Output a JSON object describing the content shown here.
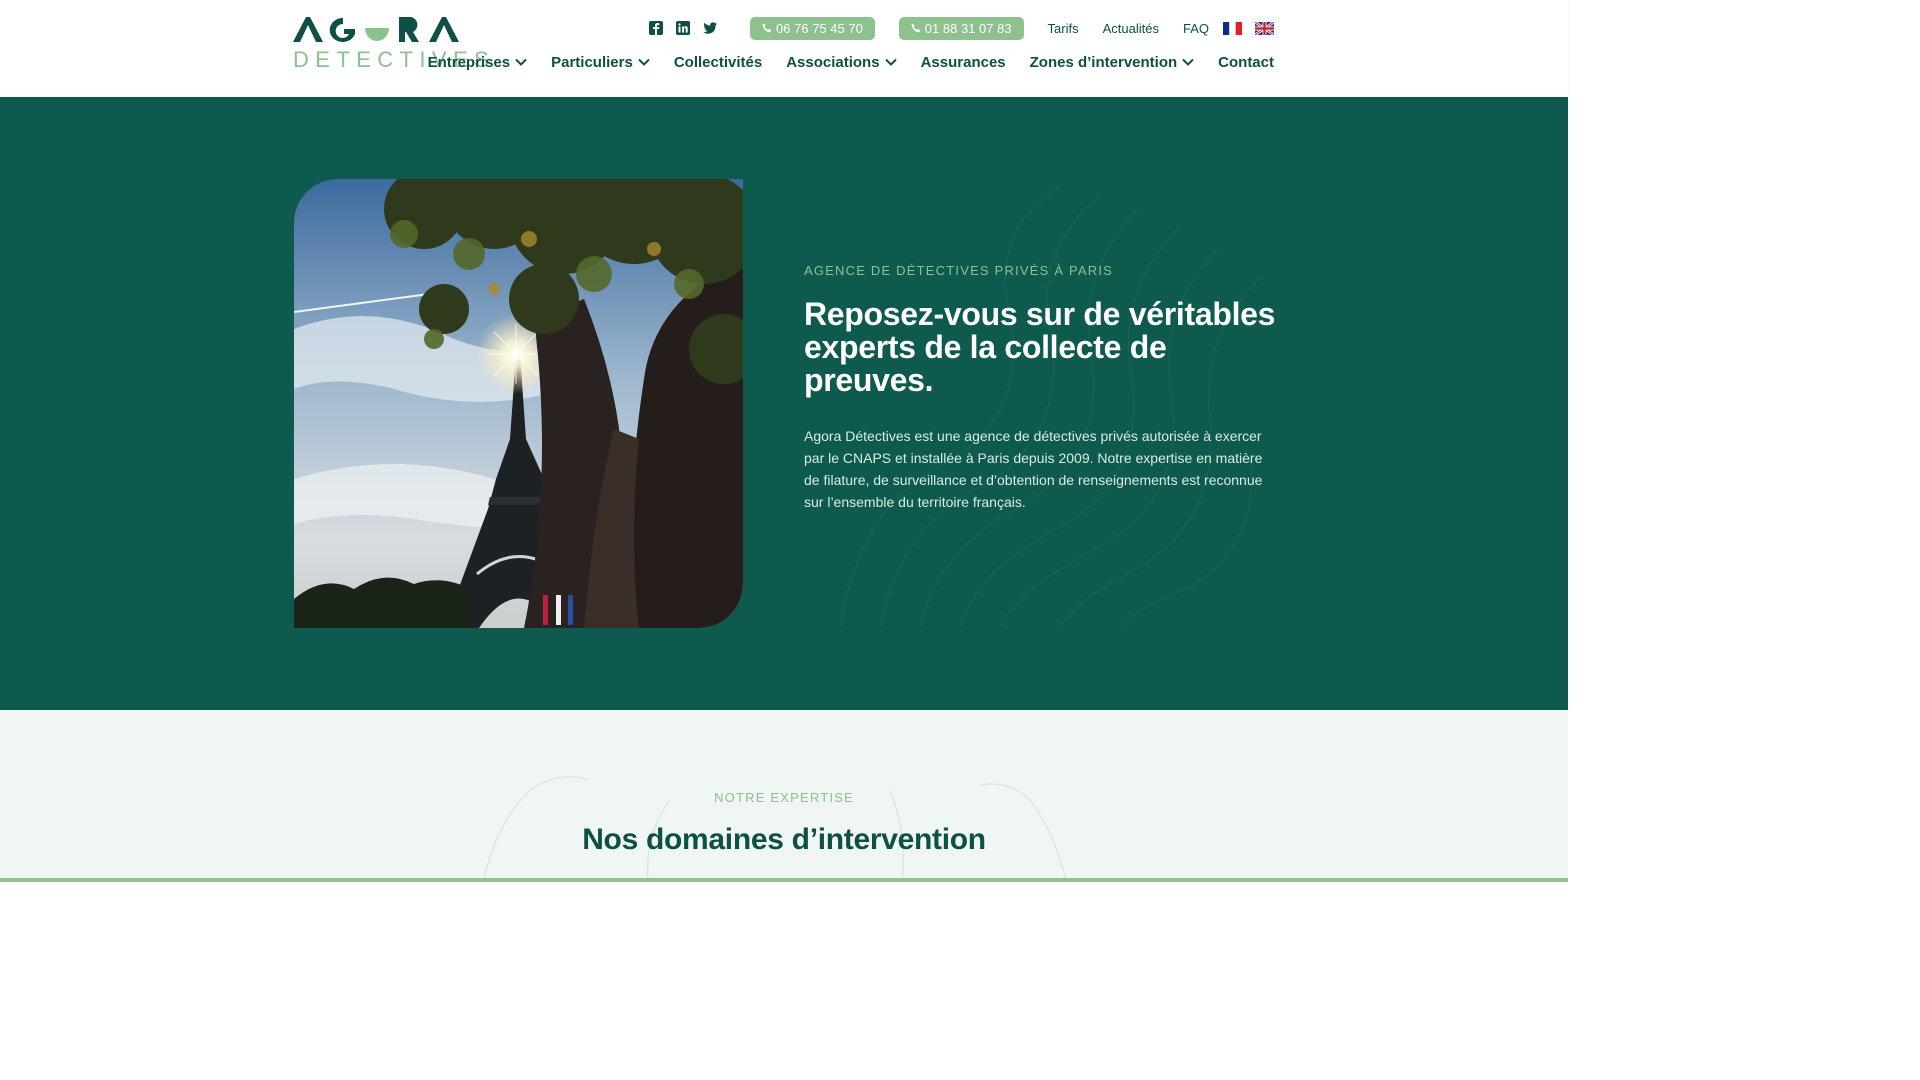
{
  "header": {
    "logo": {
      "top_text": "AGORA",
      "bottom_text": "DETECTIVES"
    },
    "social": [
      {
        "icon": "facebook-icon"
      },
      {
        "icon": "linkedin-icon"
      },
      {
        "icon": "twitter-icon"
      }
    ],
    "phones": [
      "06 76 75 45 70",
      "01 88 31 07 83"
    ],
    "top_links": [
      "Tarifs",
      "Actualités",
      "FAQ"
    ],
    "languages": [
      {
        "icon": "flag-fr-icon",
        "label": "FR"
      },
      {
        "icon": "flag-uk-icon",
        "label": "EN"
      }
    ],
    "nav": [
      {
        "label": "Entreprises",
        "has_dropdown": true
      },
      {
        "label": "Particuliers",
        "has_dropdown": true
      },
      {
        "label": "Collectivités",
        "has_dropdown": false
      },
      {
        "label": "Associations",
        "has_dropdown": true
      },
      {
        "label": "Assurances",
        "has_dropdown": false
      },
      {
        "label": "Zones d’intervention",
        "has_dropdown": true
      },
      {
        "label": "Contact",
        "has_dropdown": false
      }
    ]
  },
  "hero": {
    "eyebrow": "AGENCE DE DÉTECTIVES PRIVÉS À PARIS",
    "title": "Reposez-vous sur de véritables experts de la collecte de preuves.",
    "description": "Agora Détectives est une agence de détectives privés autorisée à exercer par le CNAPS et installée à Paris depuis 2009. Notre expertise en matière de filature, de surveillance et d’obtention de renseignements est reconnue sur l’ensemble du territoire français."
  },
  "expertise": {
    "eyebrow": "NOTRE EXPERTISE",
    "title": "Nos domaines d’intervention"
  },
  "colors": {
    "brand_dark": "#0e4f46",
    "hero_bg": "#0e5a4e",
    "accent_green": "#8dc18e",
    "section_bg": "#eff6f4"
  }
}
